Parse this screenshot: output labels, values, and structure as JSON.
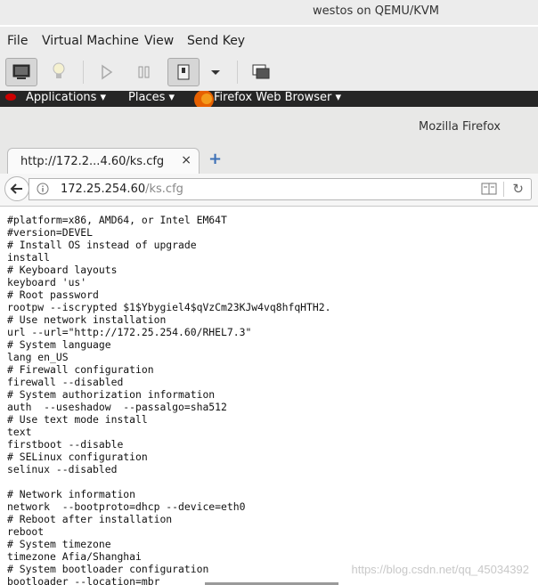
{
  "host": {
    "title": "westos on QEMU/KVM",
    "menu": [
      "File",
      "Virtual Machine",
      "View",
      "Send Key"
    ]
  },
  "guest_topbar": {
    "applications": "Applications",
    "places": "Places",
    "app": "Firefox Web Browser"
  },
  "firefox": {
    "window_title": "Mozilla Firefox",
    "tab_label": "http://172.2...4.60/ks.cfg",
    "tab_close": "×",
    "new_tab": "+",
    "url_host": "172.25.254.60",
    "url_path": "/ks.cfg"
  },
  "content": {
    "text": "#platform=x86, AMD64, or Intel EM64T\n#version=DEVEL\n# Install OS instead of upgrade\ninstall\n# Keyboard layouts\nkeyboard 'us'\n# Root password\nrootpw --iscrypted $1$Ybygiel4$qVzCm23KJw4vq8hfqHTH2.\n# Use network installation\nurl --url=\"http://172.25.254.60/RHEL7.3\"\n# System language\nlang en_US\n# Firewall configuration\nfirewall --disabled\n# System authorization information\nauth  --useshadow  --passalgo=sha512\n# Use text mode install\ntext\nfirstboot --disable\n# SELinux configuration\nselinux --disabled\n\n# Network information\nnetwork  --bootproto=dhcp --device=eth0\n# Reboot after installation\nreboot\n# System timezone\ntimezone Afia/Shanghai\n# System bootloader configuration\nbootloader --location=mbr",
    "watermark": "https://blog.csdn.net/qq_45034392"
  }
}
